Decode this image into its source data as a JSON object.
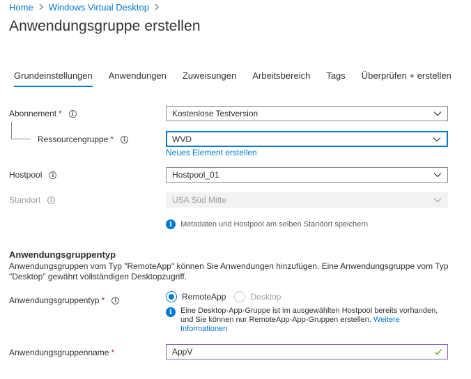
{
  "breadcrumb": {
    "home": "Home",
    "service": "Windows Virtual Desktop"
  },
  "page_title": "Anwendungsgruppe erstellen",
  "tabs": [
    {
      "label": "Grundeinstellungen",
      "active": true
    },
    {
      "label": "Anwendungen",
      "active": false
    },
    {
      "label": "Zuweisungen",
      "active": false
    },
    {
      "label": "Arbeitsbereich",
      "active": false
    },
    {
      "label": "Tags",
      "active": false
    },
    {
      "label": "Überprüfen + erstellen",
      "active": false
    }
  ],
  "form": {
    "subscription": {
      "label": "Abonnement",
      "required": "*",
      "value": "Kostenlose Testversion"
    },
    "resource_group": {
      "label": "Ressourcengruppe",
      "required": "*",
      "value": "WVD",
      "create_new_link": "Neues Element erstellen"
    },
    "hostpool": {
      "label": "Hostpool",
      "value": "Hostpool_01"
    },
    "location": {
      "label": "Standort",
      "value": "USA Süd Mitte",
      "info_message": "Metadaten und Hostpool am selben Standort speichern"
    }
  },
  "app_group_type_section": {
    "heading": "Anwendungsgruppentyp",
    "description": "Anwendungsgruppen vom Typ \"RemoteApp\" können Sie Anwendungen hinzufügen. Eine Anwendungsgruppe vom Typ \"Desktop\" gewährt vollständigen Desktopzugriff.",
    "type_field": {
      "label": "Anwendungsgruppentyp",
      "required": "*",
      "options": [
        "RemoteApp",
        "Desktop"
      ],
      "selected": "RemoteApp"
    },
    "info_message": "Eine Desktop-App-Gruppe ist im ausgewählten Hostpool bereits vorhanden, und Sie können nur RemoteApp-App-Gruppen erstellen.",
    "info_link": "Weitere Informationen",
    "name_field": {
      "label": "Anwendungsgruppenname",
      "required": "*",
      "value": "AppV"
    }
  },
  "colors": {
    "accent": "#0078d4",
    "required": "#a4262c",
    "valid_check": "#57a300",
    "valid_border": "#8764b8"
  }
}
